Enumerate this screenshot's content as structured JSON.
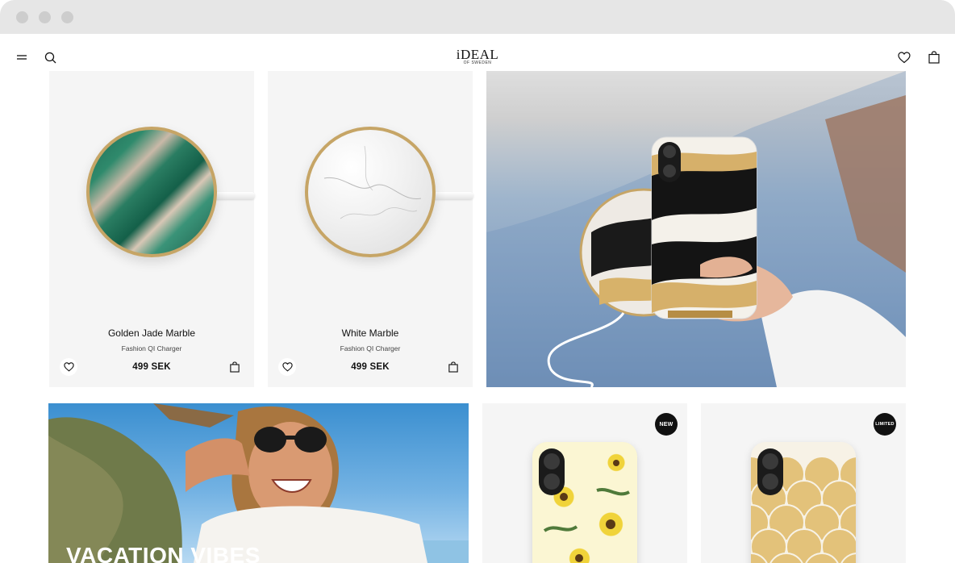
{
  "header": {
    "logo": "iDEAL",
    "logo_sub": "OF SWEDEN"
  },
  "products": [
    {
      "name": "Golden Jade Marble",
      "type": "Fashion QI Charger",
      "price": "499 SEK"
    },
    {
      "name": "White Marble",
      "type": "Fashion QI Charger",
      "price": "499 SEK"
    }
  ],
  "banner": {
    "title": "VACATION VIBES"
  },
  "cases": [
    {
      "badge": "NEW"
    },
    {
      "badge": "LIMITED"
    }
  ],
  "colors": {
    "chrome": "#e6e6e6",
    "card_bg": "#f5f5f5",
    "gold": "#c6a566",
    "badge": "#111111"
  },
  "icons": [
    "menu-icon",
    "search-icon",
    "heart-icon",
    "bag-icon"
  ]
}
